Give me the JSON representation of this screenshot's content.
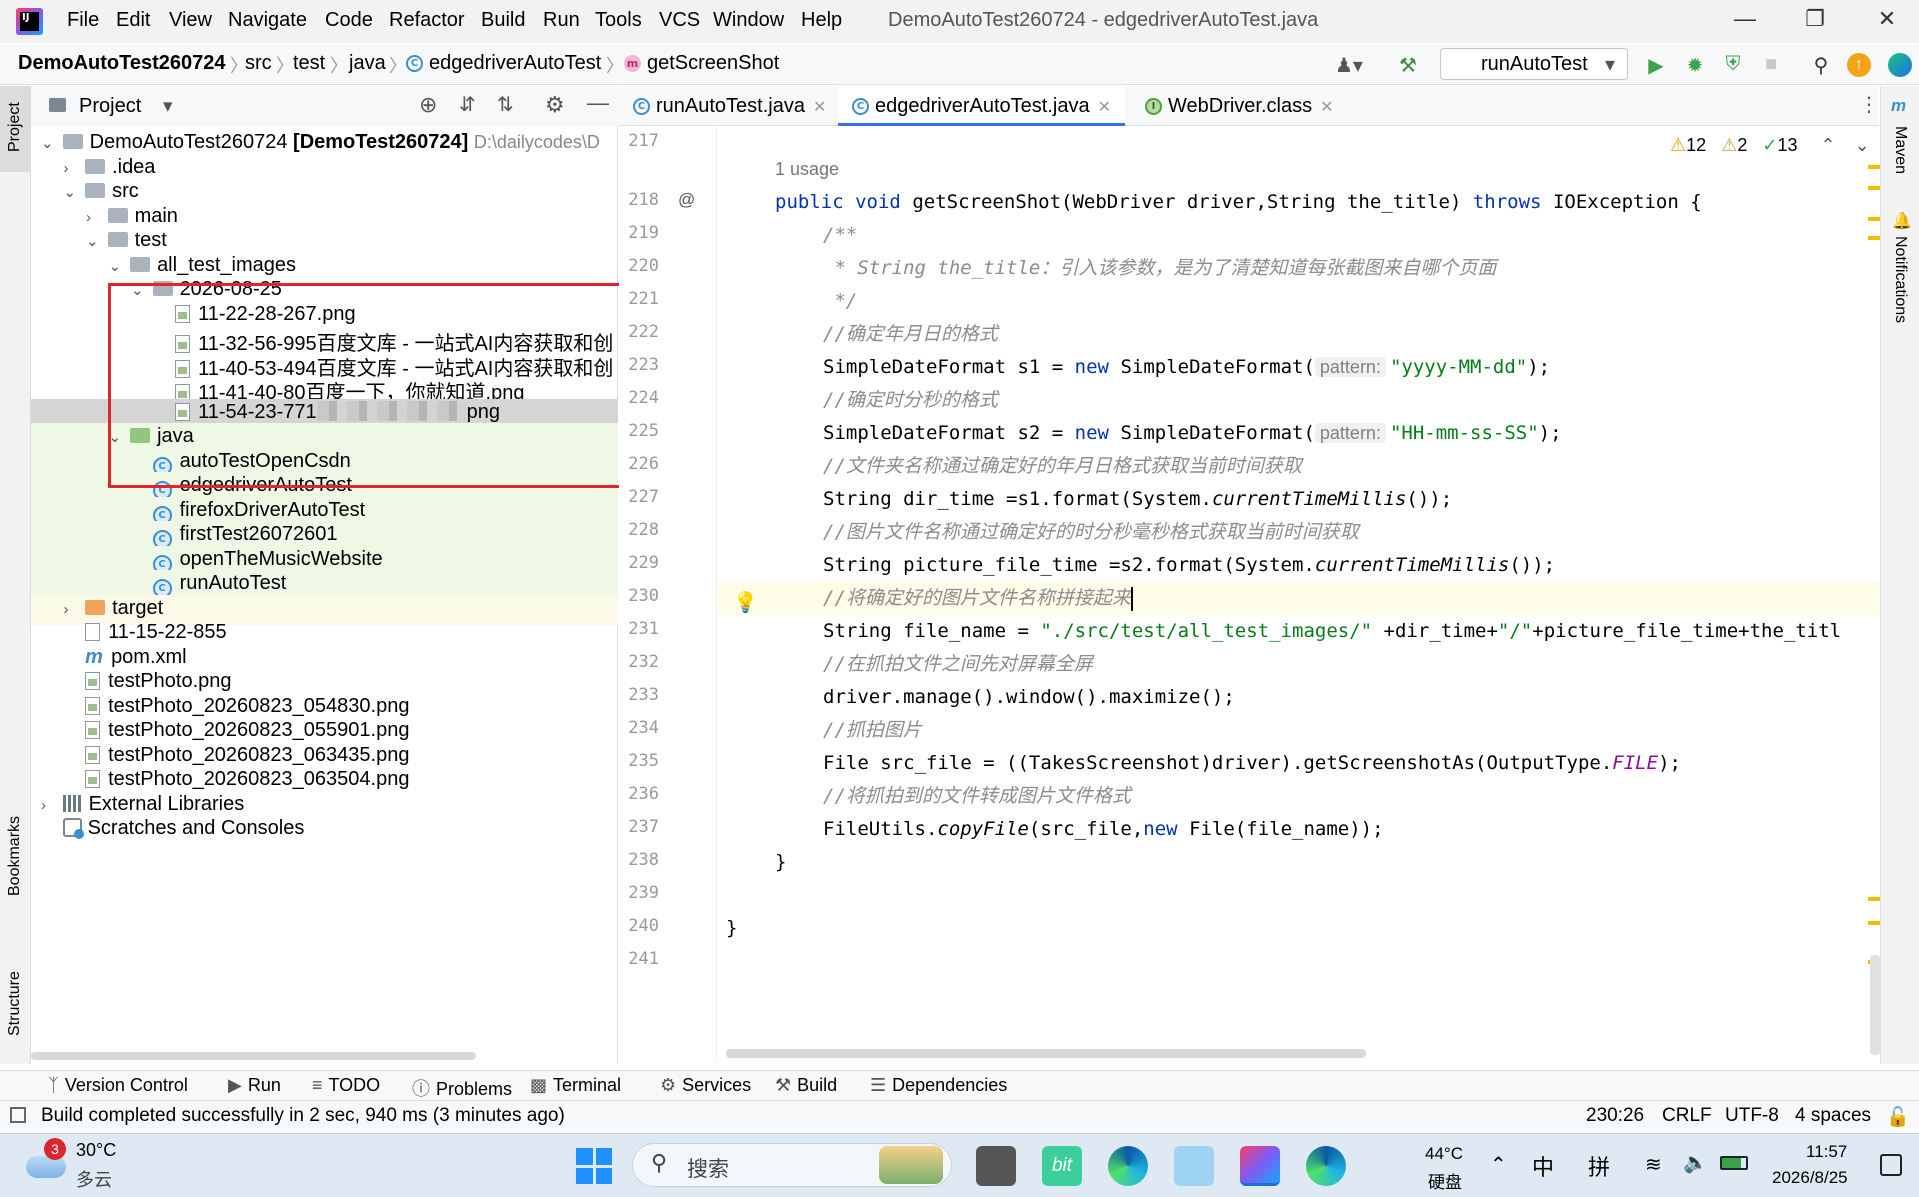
{
  "menu": [
    "File",
    "Edit",
    "View",
    "Navigate",
    "Code",
    "Refactor",
    "Build",
    "Run",
    "Tools",
    "VCS",
    "Window",
    "Help"
  ],
  "window_title": "DemoAutoTest260724 - edgedriverAutoTest.java",
  "breadcrumb": [
    "DemoAutoTest260724",
    "src",
    "test",
    "java",
    "edgedriverAutoTest",
    "getScreenShot"
  ],
  "run_config": "runAutoTest",
  "project_header": "Project",
  "left_tools": {
    "project": "Project",
    "bookmarks": "Bookmarks",
    "structure": "Structure"
  },
  "right_tools": {
    "maven": "Maven",
    "notifications": "Notifications"
  },
  "tree": [
    {
      "text": "DemoAutoTest260724",
      "bold": "[DemoTest260724]",
      "extra": "D:\\dailycodes\\D",
      "indent": 0,
      "arrow": "v",
      "icon": "folder"
    },
    {
      "text": ".idea",
      "indent": 1,
      "arrow": ">",
      "icon": "folder"
    },
    {
      "text": "src",
      "indent": 1,
      "arrow": "v",
      "icon": "folder"
    },
    {
      "text": "main",
      "indent": 2,
      "arrow": ">",
      "icon": "folder"
    },
    {
      "text": "test",
      "indent": 2,
      "arrow": "v",
      "icon": "folder"
    },
    {
      "text": "all_test_images",
      "indent": 3,
      "arrow": "v",
      "icon": "folder"
    },
    {
      "text": "2026-08-25",
      "indent": 4,
      "arrow": "v",
      "icon": "folder"
    },
    {
      "text": "11-22-28-267.png",
      "indent": 5,
      "arrow": "",
      "icon": "png"
    },
    {
      "text": "11-32-56-995百度文库 - 一站式AI内容获取和创",
      "indent": 5,
      "arrow": "",
      "icon": "png"
    },
    {
      "text": "11-40-53-494百度文库 - 一站式AI内容获取和创",
      "indent": 5,
      "arrow": "",
      "icon": "png"
    },
    {
      "text": "11-41-40-80百度一下，你就知道.png",
      "indent": 5,
      "arrow": "",
      "icon": "png"
    },
    {
      "text": "11-54-23-771",
      "suffix": "png",
      "blur": true,
      "indent": 5,
      "arrow": "",
      "icon": "png",
      "selected": true
    },
    {
      "text": "java",
      "indent": 3,
      "arrow": "v",
      "icon": "test-folder",
      "green": true
    },
    {
      "text": "autoTestOpenCsdn",
      "indent": 4,
      "arrow": "",
      "icon": "class",
      "green": true
    },
    {
      "text": "edgedriverAutoTest",
      "indent": 4,
      "arrow": "",
      "icon": "class",
      "green": true
    },
    {
      "text": "firefoxDriverAutoTest",
      "indent": 4,
      "arrow": "",
      "icon": "class",
      "green": true
    },
    {
      "text": "firstTest26072601",
      "indent": 4,
      "arrow": "",
      "icon": "class",
      "green": true
    },
    {
      "text": "openTheMusicWebsite",
      "indent": 4,
      "arrow": "",
      "icon": "class",
      "green": true
    },
    {
      "text": "runAutoTest",
      "indent": 4,
      "arrow": "",
      "icon": "class",
      "green": true
    },
    {
      "text": "target",
      "indent": 1,
      "arrow": ">",
      "icon": "orange-folder",
      "yellow": true
    },
    {
      "text": "11-15-22-855",
      "indent": 1,
      "arrow": "",
      "icon": "file"
    },
    {
      "text": "pom.xml",
      "indent": 1,
      "arrow": "",
      "icon": "maven"
    },
    {
      "text": "testPhoto.png",
      "indent": 1,
      "arrow": "",
      "icon": "png"
    },
    {
      "text": "testPhoto_20260823_054830.png",
      "indent": 1,
      "arrow": "",
      "icon": "png"
    },
    {
      "text": "testPhoto_20260823_055901.png",
      "indent": 1,
      "arrow": "",
      "icon": "png"
    },
    {
      "text": "testPhoto_20260823_063435.png",
      "indent": 1,
      "arrow": "",
      "icon": "png"
    },
    {
      "text": "testPhoto_20260823_063504.png",
      "indent": 1,
      "arrow": "",
      "icon": "png"
    },
    {
      "text": "External Libraries",
      "indent": 0,
      "arrow": ">",
      "icon": "lib"
    },
    {
      "text": "Scratches and Consoles",
      "indent": 0,
      "arrow": "",
      "icon": "scratch"
    }
  ],
  "editor_tabs": [
    {
      "label": "runAutoTest.java",
      "icon": "C",
      "active": false
    },
    {
      "label": "edgedriverAutoTest.java",
      "icon": "C",
      "active": true
    },
    {
      "label": "WebDriver.class",
      "icon": "I",
      "active": false
    }
  ],
  "inspections": {
    "warnings": "12",
    "weak": "2",
    "ok": "13"
  },
  "line_numbers": [
    "217",
    "218",
    "219",
    "220",
    "221",
    "222",
    "223",
    "224",
    "225",
    "226",
    "227",
    "228",
    "229",
    "230",
    "231",
    "232",
    "233",
    "234",
    "235",
    "236",
    "237",
    "238",
    "239",
    "240",
    "241"
  ],
  "code": {
    "usage": "1 usage",
    "l218": [
      "public",
      "void",
      "getScreenShot(WebDriver driver,String the_title)",
      "throws",
      "IOException {"
    ],
    "l219": "/**",
    "l220": " * String the_title：引入该参数，是为了清楚知道每张截图来自哪个页面",
    "l221": " */",
    "l222": "//确定年月日的格式",
    "l223": [
      "SimpleDateFormat s1 = ",
      "new",
      " SimpleDateFormat(",
      "pattern:",
      "\"yyyy-MM-dd\"",
      ");"
    ],
    "l224": "//确定时分秒的格式",
    "l225": [
      "SimpleDateFormat s2 = ",
      "new",
      " SimpleDateFormat(",
      "pattern:",
      "\"HH-mm-ss-SS\"",
      ");"
    ],
    "l226": "//文件夹名称通过确定好的年月日格式获取当前时间获取",
    "l227": [
      "String dir_time =s1.format(System.",
      "currentTimeMillis",
      "());"
    ],
    "l228": "//图片文件名称通过确定好的时分秒毫秒格式获取当前时间获取",
    "l229": [
      "String picture_file_time =s2.format(System.",
      "currentTimeMillis",
      "());"
    ],
    "l230": "//将确定好的图片文件名称拼接起来",
    "l231": [
      "String file_name = ",
      "\"./src/test/all_test_images/\"",
      " +dir_time+",
      "\"/\"",
      "+picture_file_time+the_titl"
    ],
    "l232": "//在抓拍文件之间先对屏幕全屏",
    "l233": "driver.manage().window().maximize();",
    "l234": "//抓拍图片",
    "l235": [
      "File src_file = ((TakesScreenshot)driver).getScreenshotAs(OutputType.",
      "FILE",
      ");"
    ],
    "l236": "//将抓拍到的文件转成图片文件格式",
    "l237": [
      "FileUtils.",
      "copyFile",
      "(src_file,",
      "new",
      " File(file_name));"
    ],
    "l238": "}",
    "l240": "}"
  },
  "tool_tabs": [
    "Version Control",
    "Run",
    "TODO",
    "Problems",
    "Terminal",
    "Services",
    "Build",
    "Dependencies"
  ],
  "status": {
    "message": "Build completed successfully in 2 sec, 940 ms (3 minutes ago)",
    "position": "230:26",
    "line_sep": "CRLF",
    "encoding": "UTF-8",
    "indent": "4 spaces"
  },
  "taskbar": {
    "weather_temp": "30°C",
    "weather_desc": "多云",
    "weather_badge": "3",
    "search": "搜索",
    "cpu_temp": "44°C",
    "cpu_label": "硬盘",
    "ime1": "中",
    "ime2": "拼",
    "time": "11:57",
    "date": "2026/8/25"
  }
}
